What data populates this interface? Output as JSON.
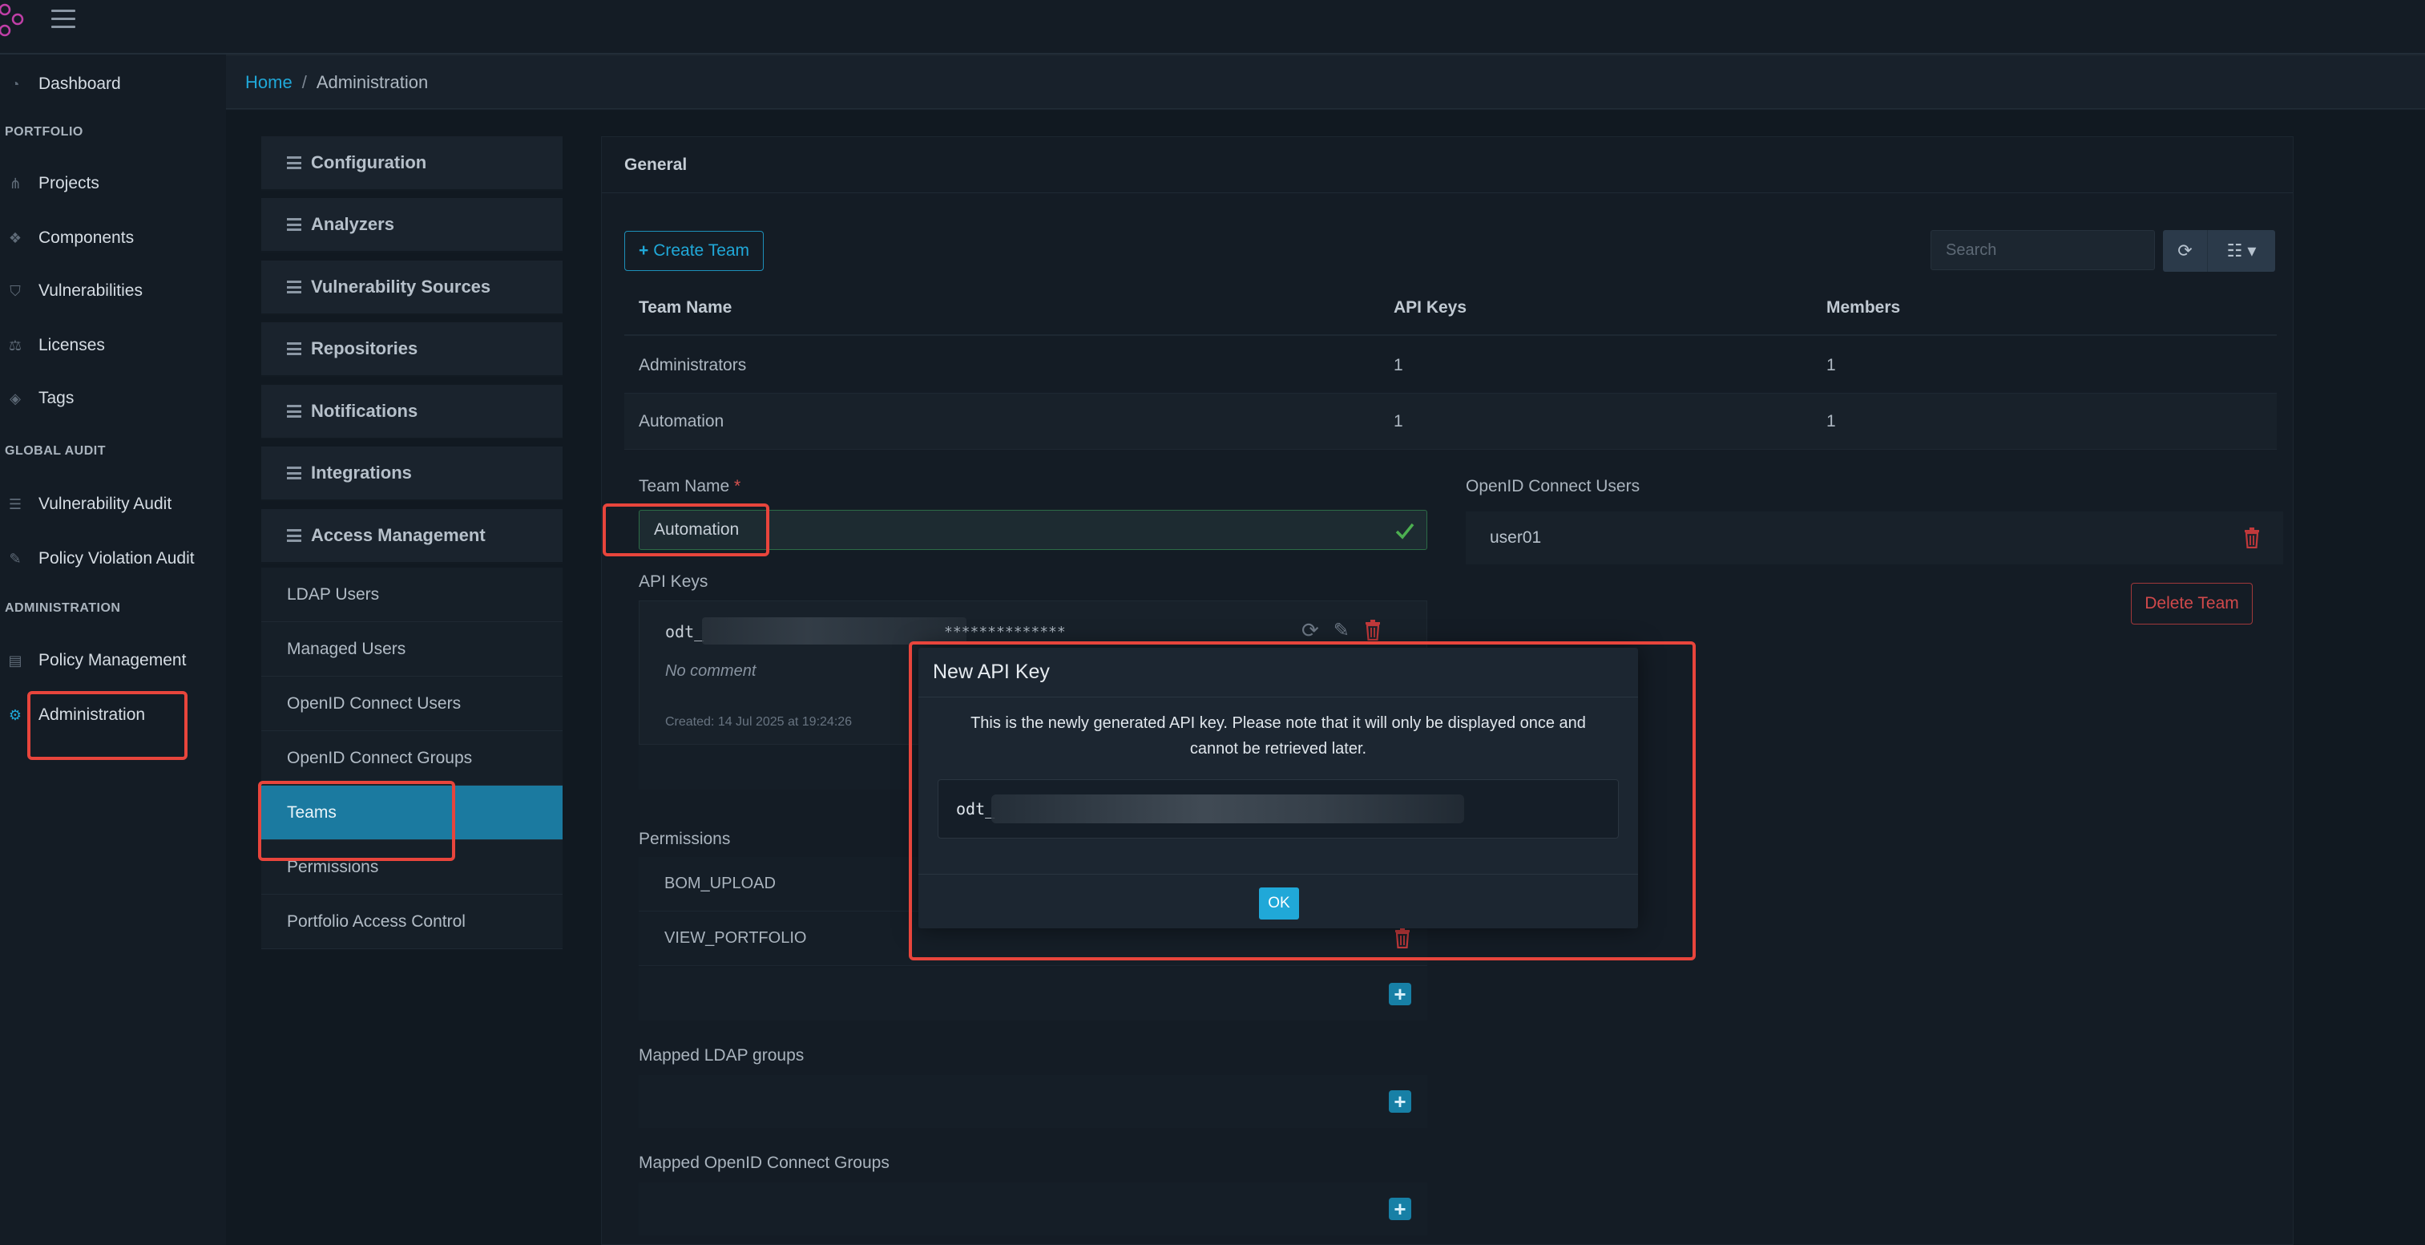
{
  "sidebar": {
    "dashboard": "Dashboard",
    "sections": {
      "portfolio": "PORTFOLIO",
      "global_audit": "GLOBAL AUDIT",
      "administration": "ADMINISTRATION"
    },
    "items": {
      "projects": "Projects",
      "components": "Components",
      "vulnerabilities": "Vulnerabilities",
      "licenses": "Licenses",
      "tags": "Tags",
      "vulnerability_audit": "Vulnerability Audit",
      "policy_violation_audit": "Policy Violation Audit",
      "policy_management": "Policy Management",
      "administration": "Administration"
    }
  },
  "breadcrumb": {
    "home": "Home",
    "separator": "/",
    "current": "Administration"
  },
  "admin_menu": {
    "configuration": "Configuration",
    "analyzers": "Analyzers",
    "vulnerability_sources": "Vulnerability Sources",
    "repositories": "Repositories",
    "notifications": "Notifications",
    "integrations": "Integrations",
    "access_management": "Access Management",
    "sub": {
      "ldap_users": "LDAP Users",
      "managed_users": "Managed Users",
      "openid_connect_users": "OpenID Connect Users",
      "openid_connect_groups": "OpenID Connect Groups",
      "teams": "Teams",
      "permissions": "Permissions",
      "portfolio_access_control": "Portfolio Access Control"
    }
  },
  "general": {
    "title": "General",
    "create_team": "Create Team",
    "search_placeholder": "Search",
    "columns": {
      "team_name": "Team Name",
      "api_keys": "API Keys",
      "members": "Members"
    },
    "rows": [
      {
        "name": "Administrators",
        "api_keys": "1",
        "members": "1"
      },
      {
        "name": "Automation",
        "api_keys": "1",
        "members": "1"
      }
    ]
  },
  "team_detail": {
    "team_name_label": "Team Name",
    "required_mark": "*",
    "team_name_value": "Automation",
    "api_keys_label": "API Keys",
    "key_prefix": "odt_",
    "key_masked": "**************",
    "no_comment": "No comment",
    "created": "Created: 14 Jul 2025 at 19:24:26",
    "permissions_label": "Permissions",
    "permissions": [
      "BOM_UPLOAD",
      "VIEW_PORTFOLIO"
    ],
    "mapped_ldap_label": "Mapped LDAP groups",
    "mapped_oidc_label": "Mapped OpenID Connect Groups",
    "oidc_users_label": "OpenID Connect Users",
    "oidc_users": [
      "user01"
    ],
    "delete_team": "Delete Team"
  },
  "modal": {
    "title": "New API Key",
    "message": "This is the newly generated API key. Please note that it will only be displayed once and cannot be retrieved later.",
    "key_prefix": "odt_",
    "ok": "OK"
  },
  "colors": {
    "accent": "#20a8d8",
    "active_menu": "#1b7aa0",
    "danger": "#d0494b",
    "highlight": "#e8453c",
    "success": "#4caf50"
  }
}
